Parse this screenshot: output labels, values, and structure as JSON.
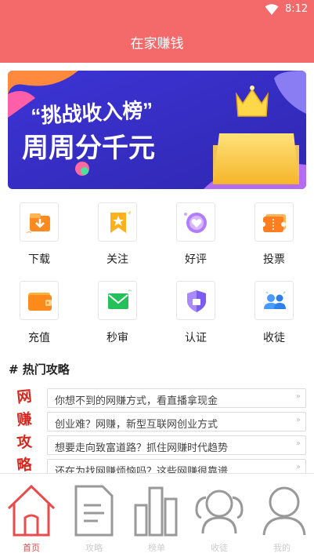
{
  "status": {
    "time": "8:12"
  },
  "header": {
    "title": "在家赚钱"
  },
  "banner": {
    "line1": "“挑战收入榜”",
    "line2": "周周分千元"
  },
  "grid": [
    {
      "label": "下载",
      "icon": "download-icon"
    },
    {
      "label": "关注",
      "icon": "bookmark-star-icon"
    },
    {
      "label": "好评",
      "icon": "heart-icon"
    },
    {
      "label": "投票",
      "icon": "ticket-icon"
    },
    {
      "label": "充值",
      "icon": "wallet-icon"
    },
    {
      "label": "秒审",
      "icon": "mail-icon"
    },
    {
      "label": "认证",
      "icon": "shield-icon"
    },
    {
      "label": "收徒",
      "icon": "people-icon"
    }
  ],
  "hot": {
    "title": "# 热门攻略",
    "side_chars": [
      "网",
      "赚",
      "攻",
      "略"
    ],
    "articles": [
      "你想不到的网赚方式，看直播拿现金",
      "创业难？网赚，新型互联网创业方式",
      "想要走向致富道路？抓住网赚时代趋势",
      "还在为找网赚烦恼吗？这些网赚很靠谱"
    ]
  },
  "tabs": [
    {
      "label": "首页",
      "icon": "home-icon",
      "active": true
    },
    {
      "label": "攻略",
      "icon": "document-icon",
      "active": false
    },
    {
      "label": "榜单",
      "icon": "chart-icon",
      "active": false
    },
    {
      "label": "收徒",
      "icon": "group-icon",
      "active": false
    },
    {
      "label": "我的",
      "icon": "user-icon",
      "active": false
    }
  ],
  "colors": {
    "primary": "#f46a6a",
    "accent": "#e84c4c",
    "banner_bg": "#3b2fc9"
  }
}
